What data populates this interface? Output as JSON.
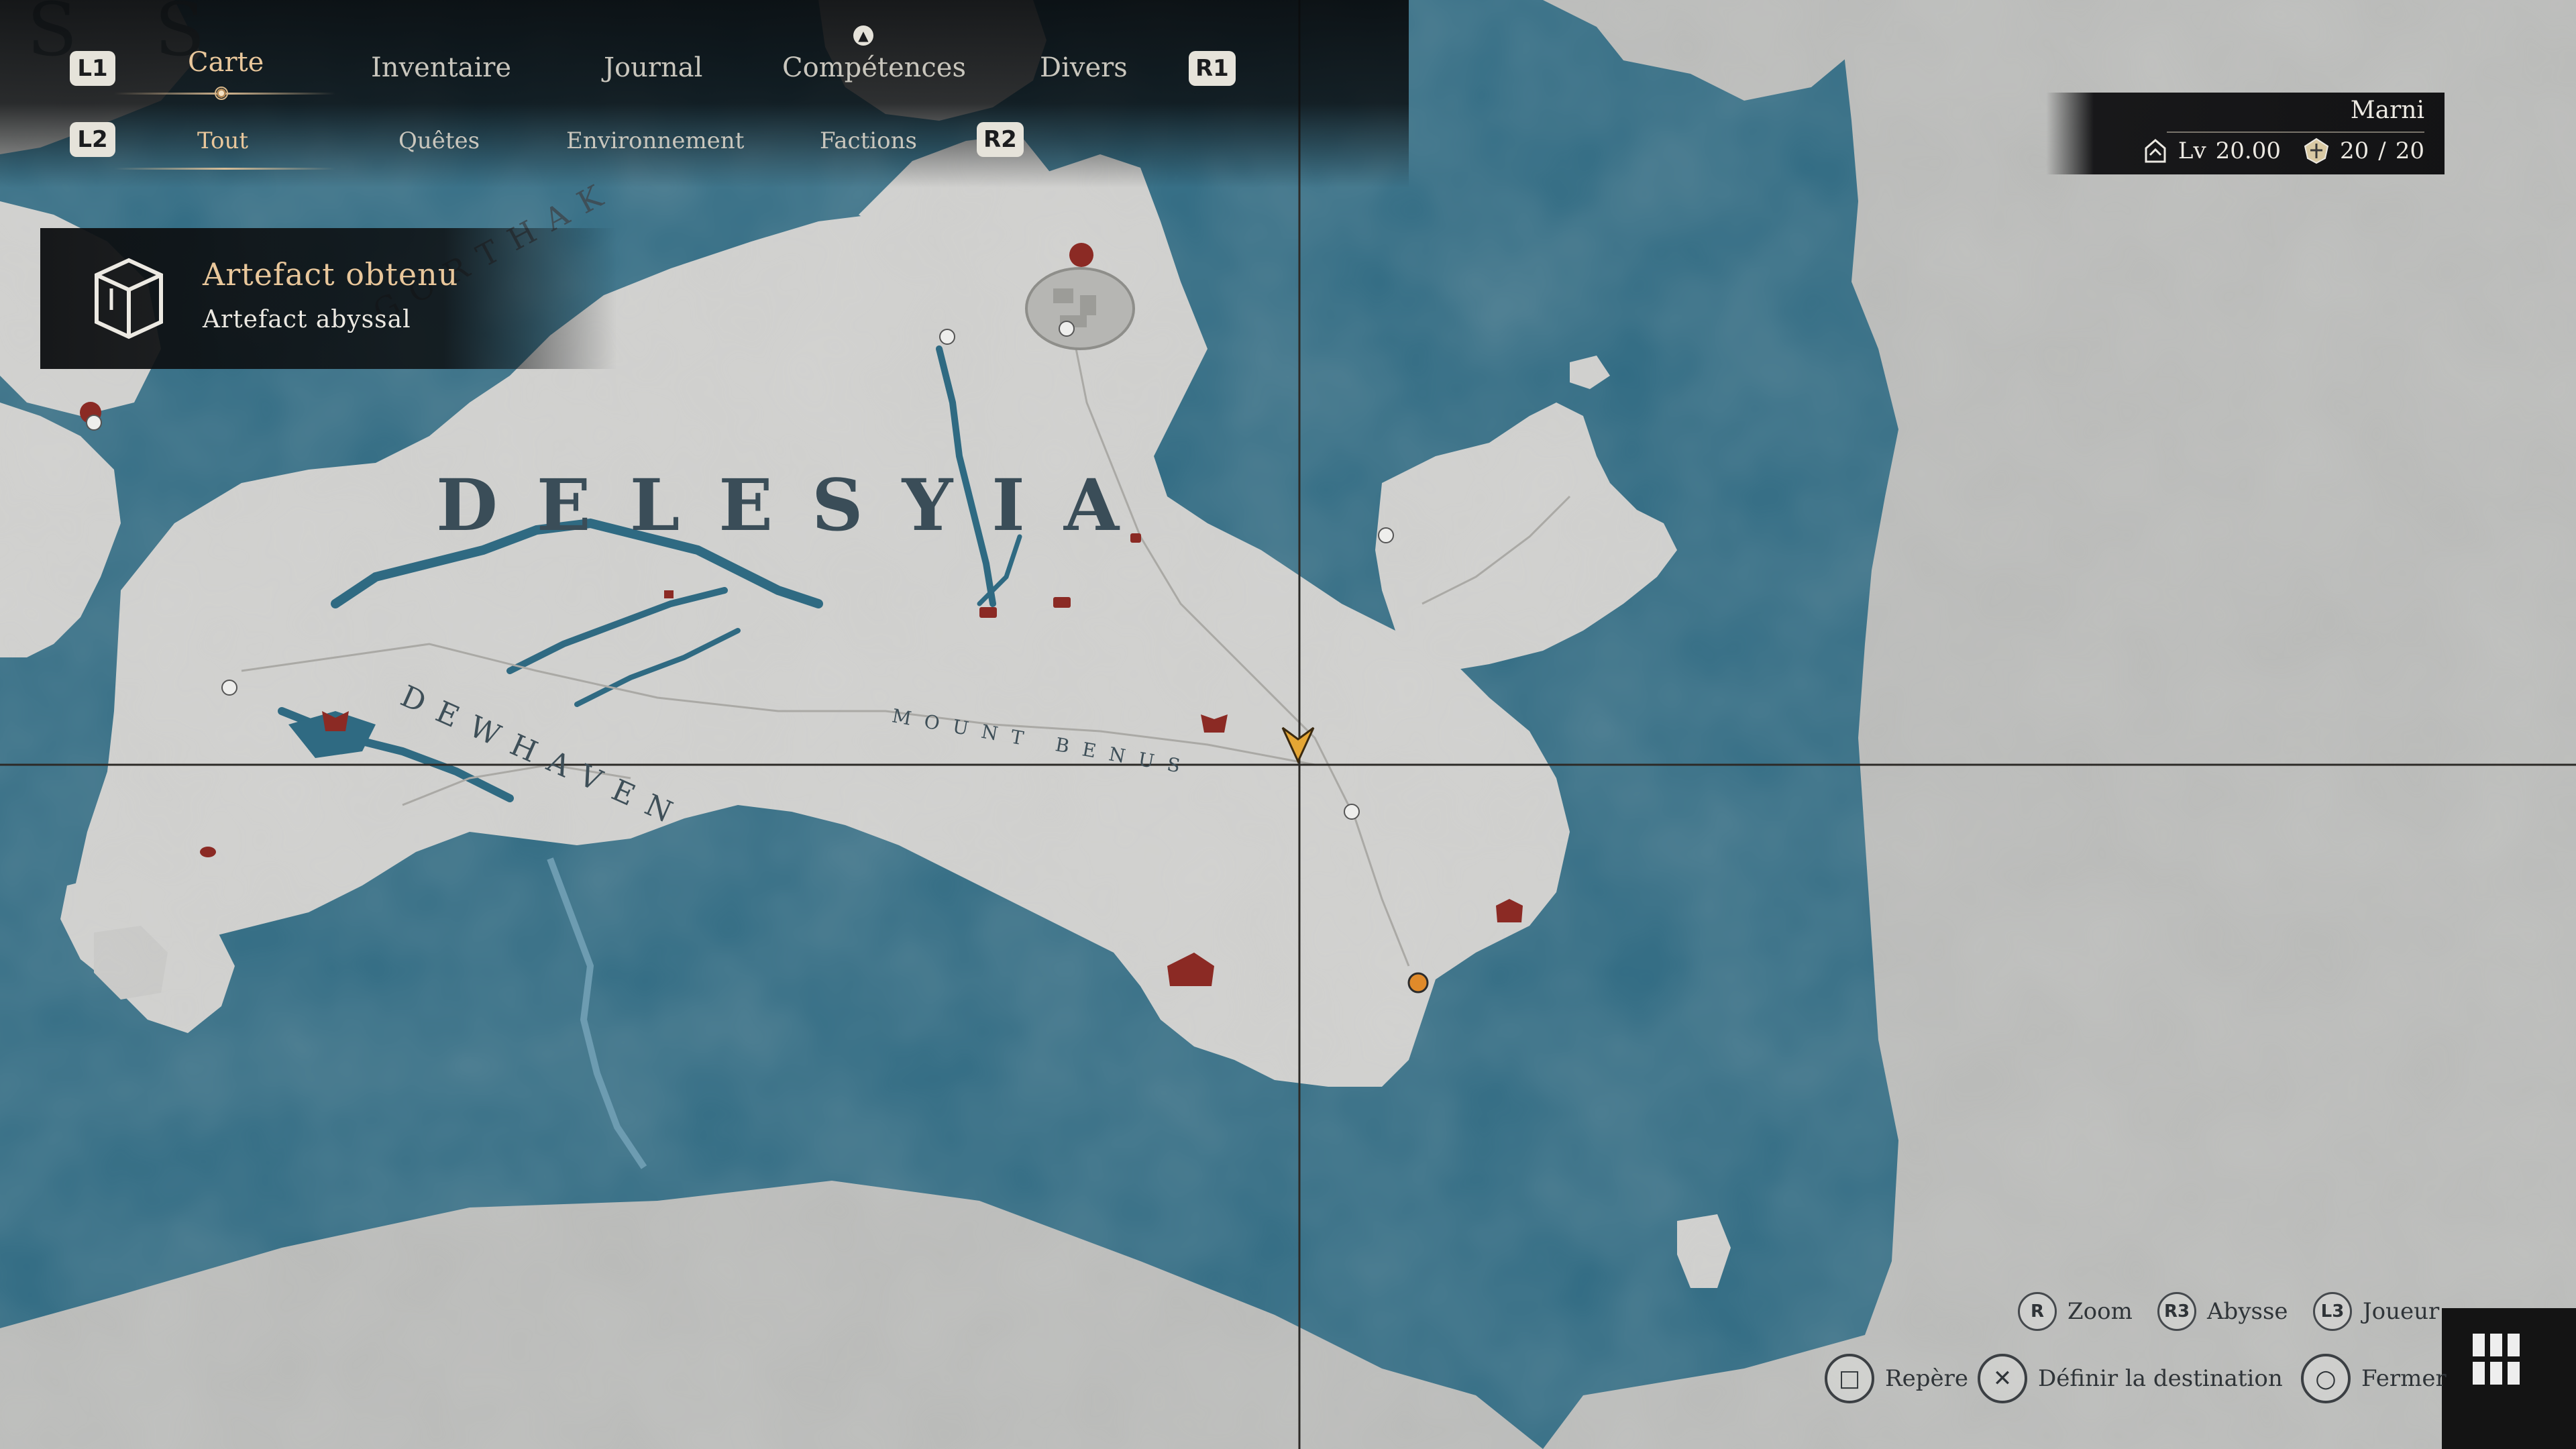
{
  "menu": {
    "left_bumper": "L1",
    "right_bumper": "R1",
    "left_trigger": "L2",
    "right_trigger": "R2",
    "tabs": [
      {
        "label": "Carte",
        "active": true
      },
      {
        "label": "Inventaire"
      },
      {
        "label": "Journal"
      },
      {
        "label": "Compétences",
        "badge": "notification-dot-icon"
      },
      {
        "label": "Divers"
      }
    ],
    "subtabs": [
      {
        "label": "Tout",
        "active": true
      },
      {
        "label": "Quêtes"
      },
      {
        "label": "Environnement"
      },
      {
        "label": "Factions"
      }
    ]
  },
  "notification": {
    "icon": "artifact-box-icon",
    "title": "Artefact obtenu",
    "subtitle": "Artefact abyssal"
  },
  "player": {
    "name": "Marni",
    "level_label": "Lv",
    "level": "20.00",
    "hp_current": "20",
    "hp_sep": "/",
    "hp_max": "20"
  },
  "map_labels": {
    "region": "DELESYIA",
    "gorthak": "GORTHAK",
    "dewhaven": "DEWHAVEN",
    "mount": "MOUNT BENUS",
    "top_partial": "S S"
  },
  "prompts": {
    "zoom": {
      "key": "R",
      "label": "Zoom"
    },
    "abysse": {
      "key": "R3",
      "label": "Abysse"
    },
    "joueur": {
      "key": "L3",
      "label": "Joueur"
    },
    "repere": {
      "key": "□",
      "label": "Repère"
    },
    "destination": {
      "key": "✕",
      "label": "Définir la destination"
    },
    "fermer": {
      "key": "○",
      "label": "Fermer"
    }
  },
  "colors": {
    "sea": "#2f6a82",
    "land": "#cfcfcd",
    "fog": "#b7b8b6",
    "accent": "#e9c79b",
    "poi_red": "#8b2a24",
    "player_marker": "#e5a634"
  }
}
